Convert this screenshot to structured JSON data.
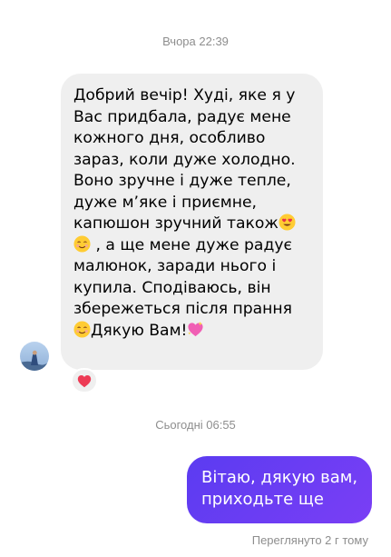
{
  "timestamps": {
    "first": "Вчора 22:39",
    "second": "Сьогодні 06:55"
  },
  "incoming_message": {
    "lines": [
      "Добрий вечір! Худі, яке я у",
      "Вас придбала, радує мене",
      "кожного дня, особливо",
      "зараз, коли дуже холодно.",
      "Воно зручне і дуже тепле,",
      "дуже м’яке і приємне,",
      "капюшон зручний також",
      " , а ще мене дуже радує",
      "малюнок, заради нього і",
      "купила. Сподіваюсь, він",
      "збережеться після прання",
      "Дякую Вам!"
    ],
    "emojis": [
      "heart-eyes-emoji",
      "smiling-blush-emoji",
      "smiling-blush-emoji",
      "sparkling-heart-emoji"
    ],
    "reaction": "red-heart-icon"
  },
  "outgoing_message": {
    "text": "Вітаю, дякую вам,\nприходьте ще"
  },
  "seen_status": "Переглянуто 2 г тому",
  "colors": {
    "incoming_bubble": "#efefef",
    "outgoing_bubble": "#5b3cf1",
    "meta_text": "#8e8e8e",
    "reaction_heart": "#ed3b55"
  }
}
